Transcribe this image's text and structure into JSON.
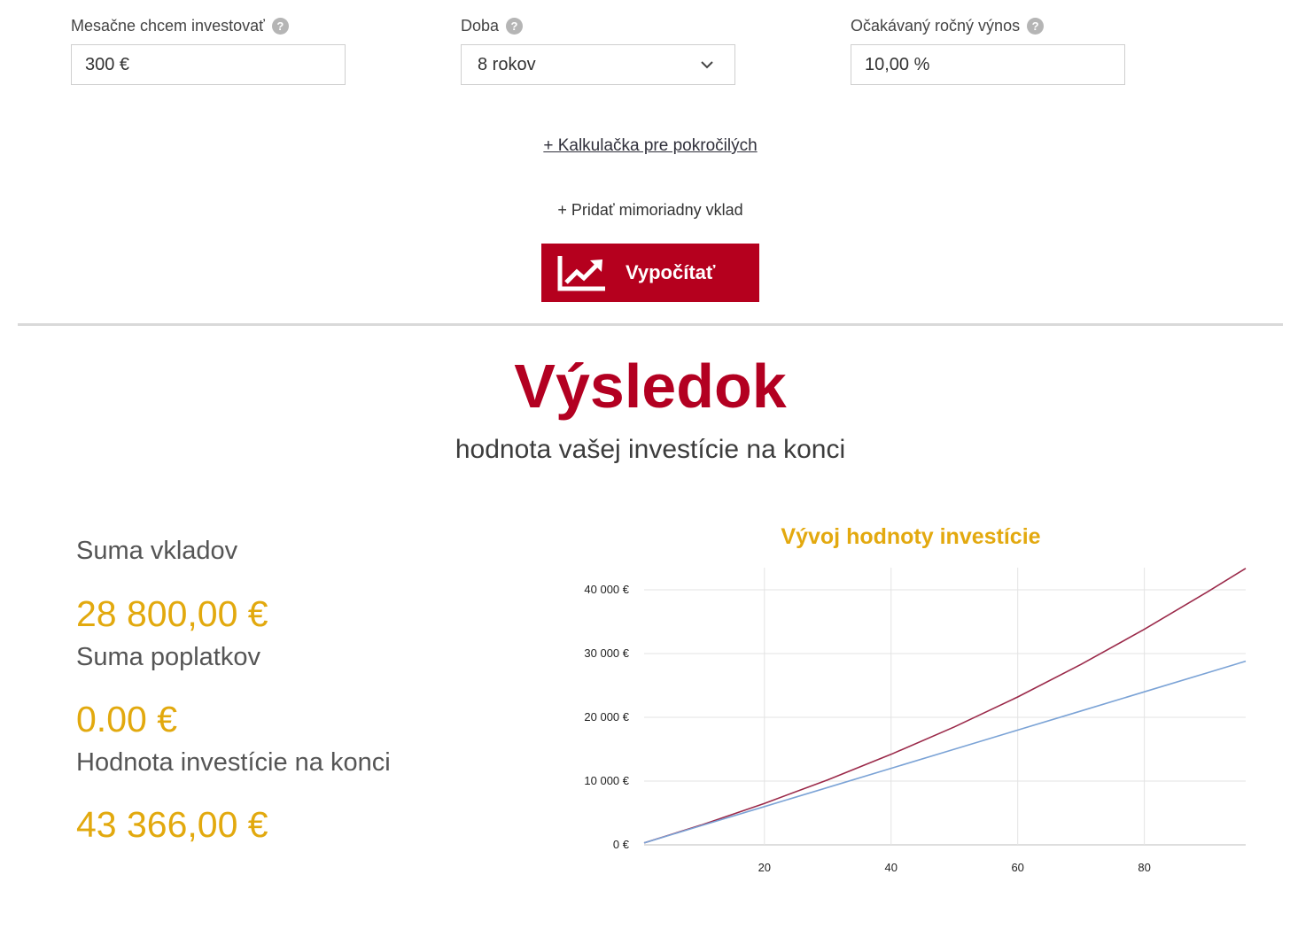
{
  "inputs": {
    "monthly": {
      "label": "Mesačne chcem investovať",
      "value": "300 €"
    },
    "period": {
      "label": "Doba",
      "value": "8 rokov"
    },
    "yield": {
      "label": "Očakávaný ročný výnos",
      "value": "10,00 %"
    }
  },
  "links": {
    "advanced": "+ Kalkulačka pre pokročilých",
    "extra_deposit": "+ Pridať mimoriadny vklad"
  },
  "button": {
    "label": "Vypočítať",
    "color": "#b5001e"
  },
  "result": {
    "title": "Výsledok",
    "subtitle": "hodnota vašej investície na konci",
    "deposits_label": "Suma vkladov",
    "deposits_value": "28 800,00 €",
    "fees_label": "Suma poplatkov",
    "fees_value": "0.00 €",
    "end_label": "Hodnota investície na konci",
    "end_value": "43 366,00 €"
  },
  "icons": [
    "help-icon",
    "chevron-down-icon",
    "chart-growth-icon"
  ],
  "colors": {
    "accent": "#b30021",
    "gold": "#e2a90e",
    "series_value": "#9b2a4a",
    "series_deposits": "#7ba3d6"
  },
  "chart_data": {
    "type": "line",
    "title": "Vývoj hodnoty investície",
    "xlim": [
      1,
      96
    ],
    "ylim": [
      0,
      40000
    ],
    "x_ticks": [
      20,
      40,
      60,
      80
    ],
    "y_tick_labels": [
      "0 €",
      "10 000 €",
      "20 000 €",
      "30 000 €",
      "40 000 €"
    ],
    "grid": true,
    "series": [
      {
        "color": "#9b2a4a",
        "x": [
          1,
          10,
          20,
          30,
          40,
          50,
          60,
          70,
          80,
          90,
          96
        ],
        "values": [
          300,
          3100,
          6500,
          10200,
          14200,
          18500,
          23200,
          28300,
          33800,
          39700,
          43366
        ]
      },
      {
        "color": "#7ba3d6",
        "x": [
          1,
          10,
          20,
          30,
          40,
          50,
          60,
          70,
          80,
          90,
          96
        ],
        "values": [
          300,
          3000,
          6000,
          9000,
          12000,
          15000,
          18000,
          21000,
          24000,
          27000,
          28800
        ]
      }
    ]
  }
}
